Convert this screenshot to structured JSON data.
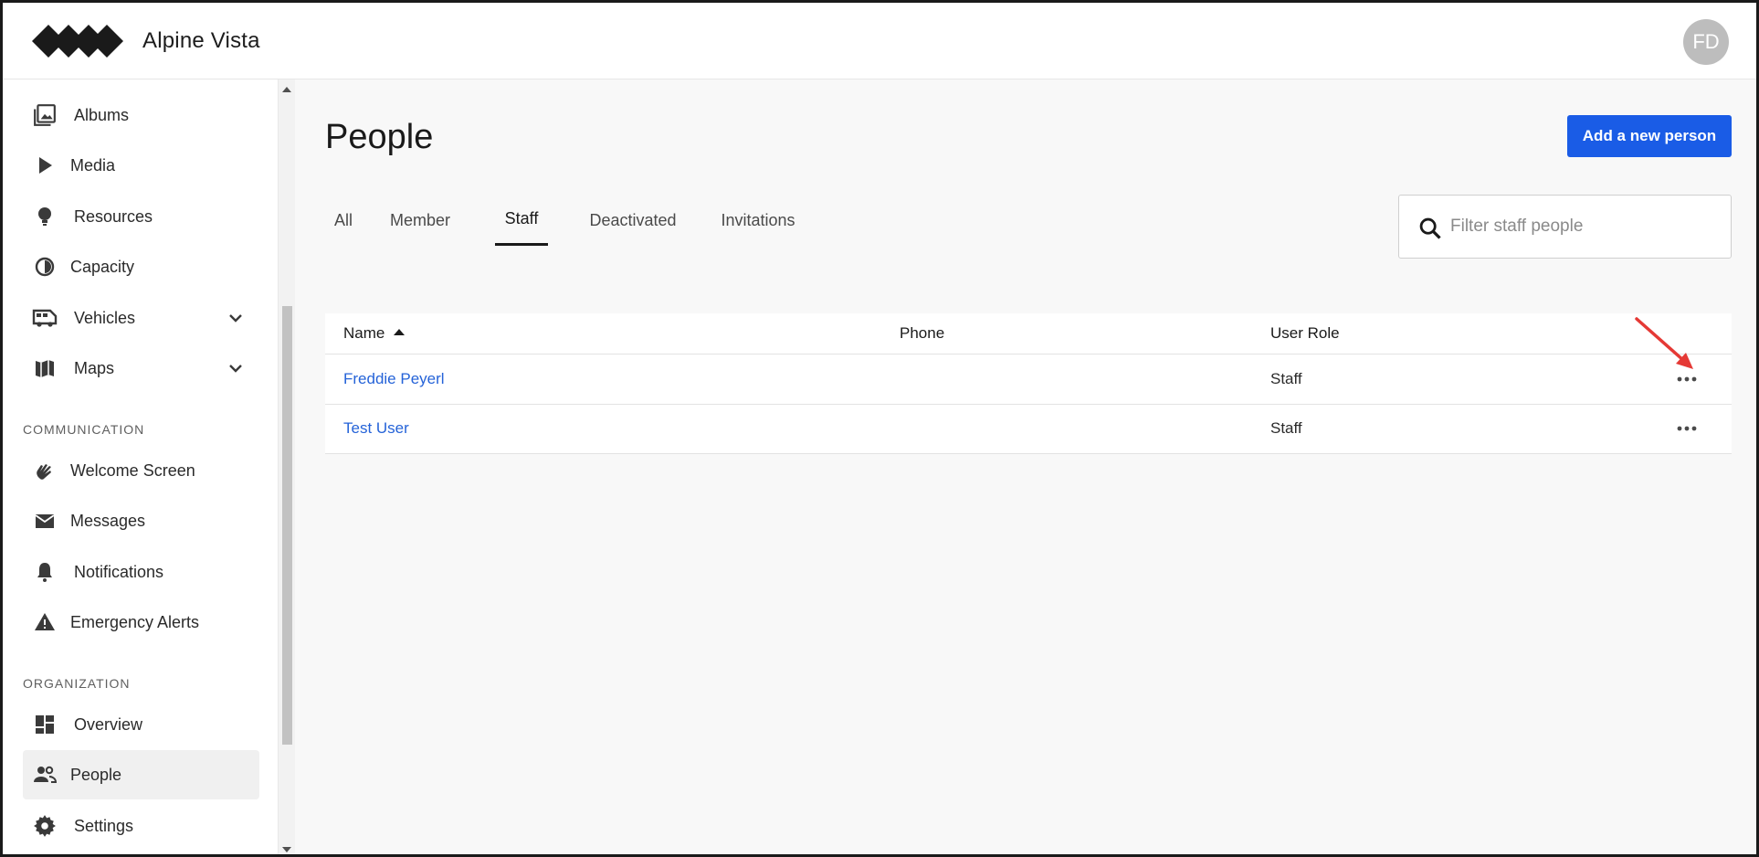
{
  "app": {
    "brand": "Alpine Vista",
    "avatar_initials": "FD"
  },
  "sidebar": {
    "items_top": [
      {
        "label": "Albums",
        "icon": "album-icon"
      },
      {
        "label": "Media",
        "icon": "play-icon"
      },
      {
        "label": "Resources",
        "icon": "lightbulb-icon"
      },
      {
        "label": "Capacity",
        "icon": "gauge-icon"
      },
      {
        "label": "Vehicles",
        "icon": "bus-icon",
        "expandable": true
      },
      {
        "label": "Maps",
        "icon": "map-icon",
        "expandable": true
      }
    ],
    "sections": [
      {
        "label": "COMMUNICATION",
        "items": [
          {
            "label": "Welcome Screen",
            "icon": "wave-hand-icon"
          },
          {
            "label": "Messages",
            "icon": "mail-icon"
          },
          {
            "label": "Notifications",
            "icon": "bell-icon"
          },
          {
            "label": "Emergency Alerts",
            "icon": "warning-icon"
          }
        ]
      },
      {
        "label": "ORGANIZATION",
        "items": [
          {
            "label": "Overview",
            "icon": "dashboard-icon"
          },
          {
            "label": "People",
            "icon": "people-icon",
            "active": true
          },
          {
            "label": "Settings",
            "icon": "gear-icon"
          }
        ]
      }
    ]
  },
  "main": {
    "title": "People",
    "add_button": "Add a new person",
    "tabs": [
      {
        "label": "All"
      },
      {
        "label": "Member"
      },
      {
        "label": "Staff",
        "active": true
      },
      {
        "label": "Deactivated"
      },
      {
        "label": "Invitations"
      }
    ],
    "search": {
      "placeholder": "Filter staff people",
      "value": ""
    },
    "table": {
      "columns": [
        "Name",
        "Phone",
        "User Role"
      ],
      "sort": {
        "column": "Name",
        "direction": "ascending"
      },
      "rows": [
        {
          "name": "Freddie Peyerl",
          "phone": "",
          "role": "Staff"
        },
        {
          "name": "Test User",
          "phone": "",
          "role": "Staff"
        }
      ]
    }
  },
  "colors": {
    "primary_button": "#1a5ce6",
    "link": "#2563d8",
    "annotation_arrow": "#e53935"
  }
}
